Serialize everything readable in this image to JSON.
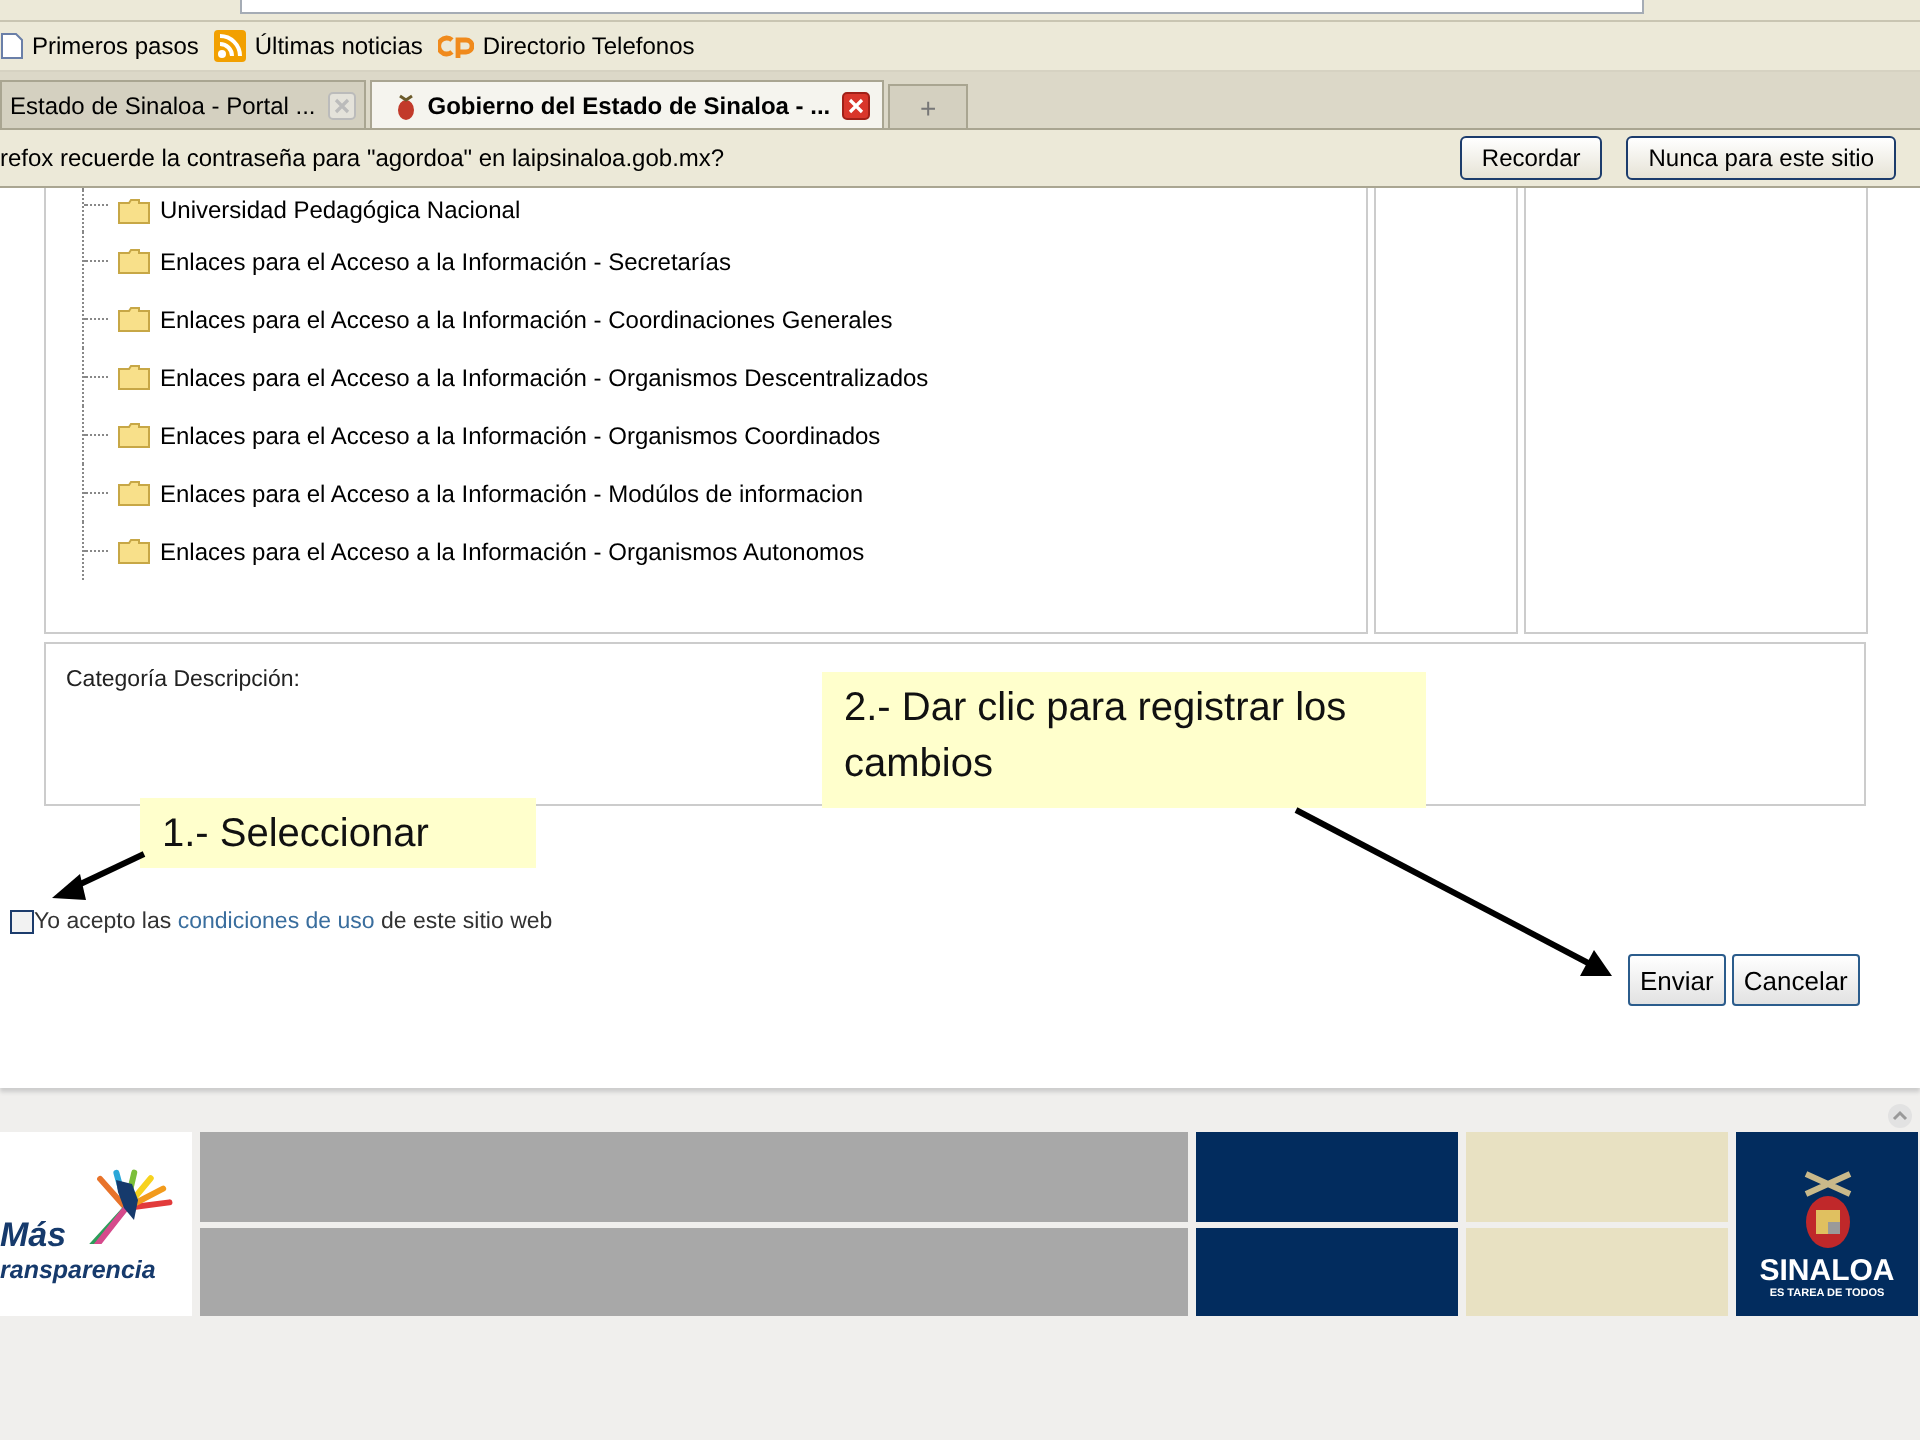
{
  "bookmarks": [
    {
      "label": "Primeros pasos",
      "kind": "page"
    },
    {
      "label": "Últimas noticias",
      "kind": "feed"
    },
    {
      "label": "Directorio Telefonos",
      "kind": "cp"
    }
  ],
  "tabs": [
    {
      "title": "Estado de Sinaloa - Portal ...",
      "selected": false
    },
    {
      "title": "Gobierno del Estado de Sinaloa - ...",
      "selected": true
    }
  ],
  "new_tab": "+",
  "password_bar": {
    "message": "refox recuerde la contraseña para \"agordoa\" en laipsinaloa.gob.mx?",
    "buttons": [
      "Recordar",
      "Nunca para este sitio"
    ]
  },
  "tree": {
    "items": [
      "Universidad Pedagógica Nacional",
      "Enlaces para el Acceso a la Información - Secretarías",
      "Enlaces para el Acceso a la Información - Coordinaciones Generales",
      "Enlaces para el Acceso a la Información - Organismos Descentralizados",
      "Enlaces para el Acceso a la Información - Organismos Coordinados",
      "Enlaces para el Acceso a la Información - Modúlos de informacion",
      "Enlaces para el Acceso a la Información - Organismos Autonomos"
    ]
  },
  "description": {
    "label": "Categoría Descripción:"
  },
  "terms": {
    "checked": false,
    "before": "Yo acepto las",
    "link": "condiciones de uso",
    "after": "de este sitio web"
  },
  "buttons": [
    "Enviar",
    "Cancelar"
  ],
  "callouts": [
    {
      "text": "1.- Seleccionar"
    },
    {
      "text": "2.- Dar clic para registrar los cambios"
    }
  ],
  "footer": {
    "logo_title": "Más",
    "logo_subtitle": "ransparencia",
    "seal_title": "SINALOA",
    "seal_subtitle": "ES TAREA DE TODOS"
  }
}
